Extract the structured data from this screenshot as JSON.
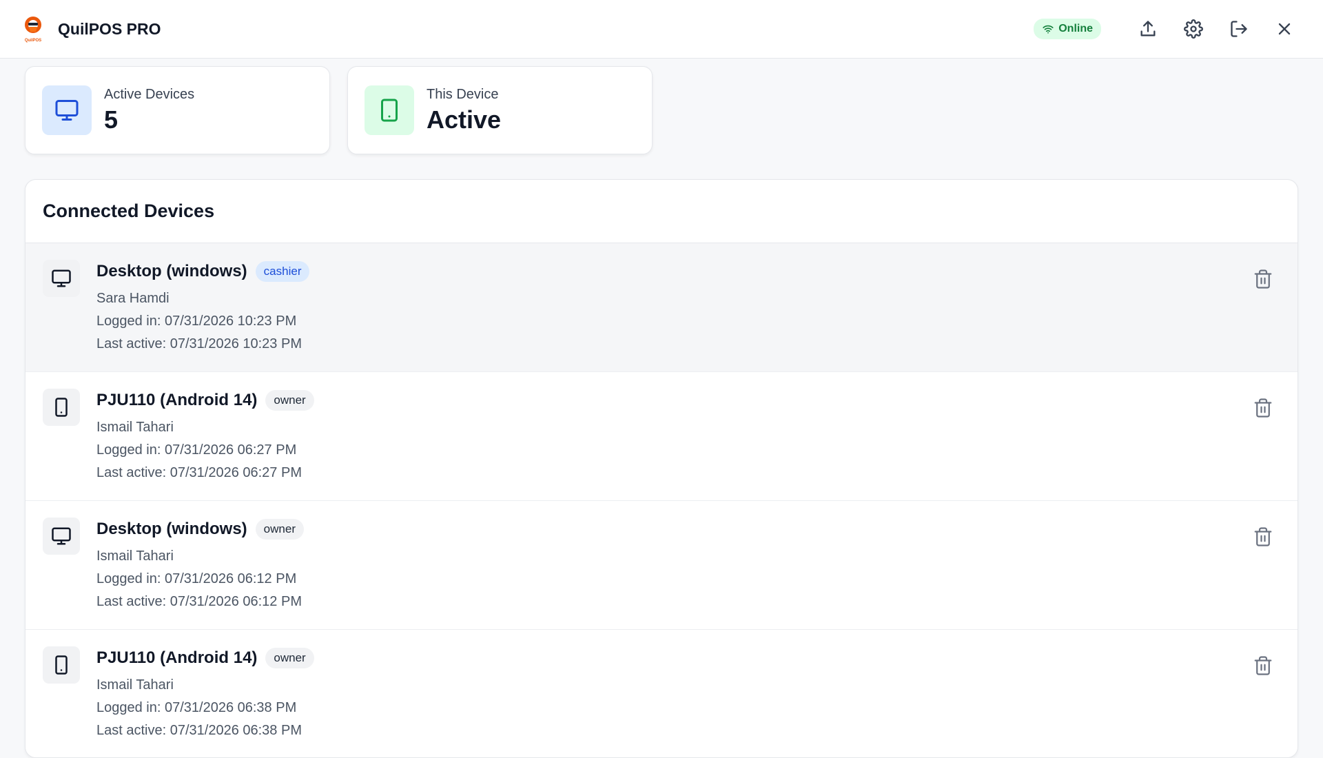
{
  "app": {
    "title": "QuilPOS PRO",
    "logo_text": "QuilPOS"
  },
  "header": {
    "status": "Online",
    "actions": [
      "upload-icon",
      "gear-icon",
      "logout-icon",
      "close-icon"
    ]
  },
  "stats": {
    "active_devices": {
      "label": "Active Devices",
      "value": "5"
    },
    "this_device": {
      "label": "This Device",
      "value": "Active"
    }
  },
  "devices": {
    "title": "Connected Devices",
    "items": [
      {
        "name": "Desktop (windows)",
        "type": "desktop",
        "role": "cashier",
        "user": "Sara Hamdi",
        "logged_in": "Logged in: 07/31/2026 10:23 PM",
        "last_active": "Last active: 07/31/2026 10:23 PM"
      },
      {
        "name": "PJU110 (Android 14)",
        "type": "mobile",
        "role": "owner",
        "user": "Ismail Tahari",
        "logged_in": "Logged in: 07/31/2026 06:27 PM",
        "last_active": "Last active: 07/31/2026 06:27 PM"
      },
      {
        "name": "Desktop (windows)",
        "type": "desktop",
        "role": "owner",
        "user": "Ismail Tahari",
        "logged_in": "Logged in: 07/31/2026 06:12 PM",
        "last_active": "Last active: 07/31/2026 06:12 PM"
      },
      {
        "name": "PJU110 (Android 14)",
        "type": "mobile",
        "role": "owner",
        "user": "Ismail Tahari",
        "logged_in": "Logged in: 07/31/2026 06:38 PM",
        "last_active": "Last active: 07/31/2026 06:38 PM"
      }
    ]
  },
  "colors": {
    "accent_blue": "#1d4ed8",
    "online_green": "#15803d",
    "logo_orange": "#ea580c"
  }
}
